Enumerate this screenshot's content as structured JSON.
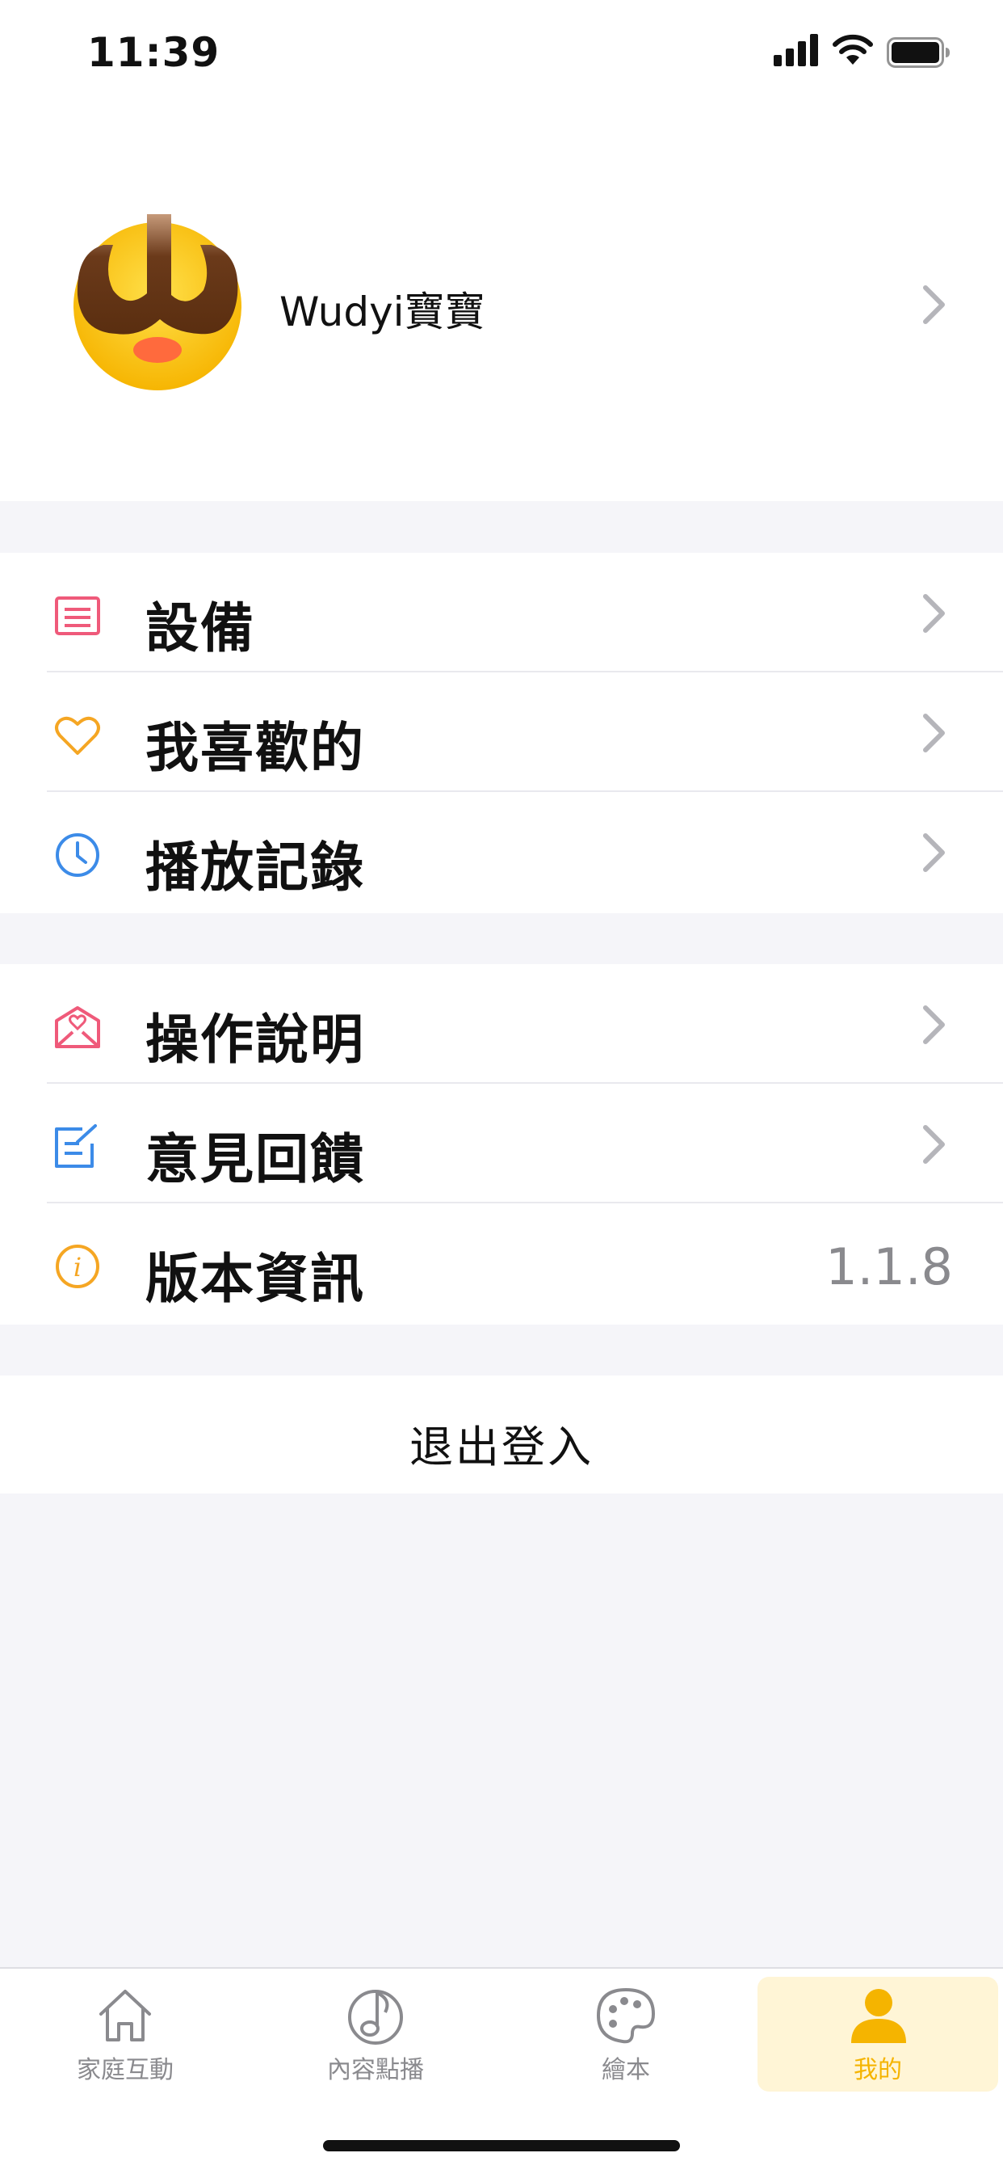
{
  "status_bar": {
    "time": "11:39"
  },
  "profile": {
    "name": "Wudyi寶寶",
    "avatar": "avatar-face"
  },
  "menu_section_1": [
    {
      "label": "設備",
      "icon": "device-icon"
    },
    {
      "label": "我喜歡的",
      "icon": "heart-icon"
    },
    {
      "label": "播放記錄",
      "icon": "clock-icon"
    }
  ],
  "menu_section_2": [
    {
      "label": "操作說明",
      "icon": "mail-heart-icon"
    },
    {
      "label": "意見回饋",
      "icon": "edit-icon"
    },
    {
      "label": "版本資訊",
      "icon": "info-icon",
      "value": "1.1.8"
    }
  ],
  "logout": {
    "label": "退出登入"
  },
  "tabs": [
    {
      "label": "家庭互動",
      "icon": "home-icon"
    },
    {
      "label": "內容點播",
      "icon": "music-note-icon"
    },
    {
      "label": "繪本",
      "icon": "palette-icon"
    },
    {
      "label": "我的",
      "icon": "person-icon",
      "active": true
    }
  ],
  "colors": {
    "accent": "#f5b400",
    "device_icon": "#ef5a7a",
    "heart_icon": "#f5a623",
    "clock_icon": "#3c8be8",
    "mail_icon": "#ef5a7a",
    "edit_icon": "#3c8be8",
    "info_icon": "#f5a623"
  }
}
